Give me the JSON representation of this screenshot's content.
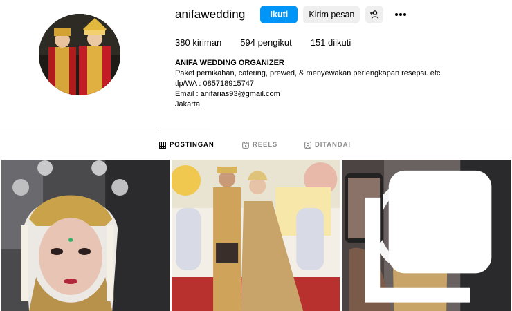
{
  "profile": {
    "username": "anifawedding",
    "follow_label": "Ikuti",
    "message_label": "Kirim pesan",
    "suggest_icon": "person-plus-icon",
    "more_icon": "more-dots-icon"
  },
  "stats": {
    "posts_count": "380",
    "posts_label": "kiriman",
    "followers_count": "594",
    "followers_label": "pengikut",
    "following_count": "151",
    "following_label": "diikuti"
  },
  "bio": {
    "name": "ANIFA WEDDING ORGANIZER",
    "line1": "Paket pernikahan, catering, prewed, & menyewakan perlengkapan resepsi. etc.",
    "line2": "tlp/WA : 085718915747",
    "line3": "Email : anifarias93@gmail.com",
    "line4": "Jakarta"
  },
  "tabs": [
    {
      "label": "POSTINGAN",
      "icon": "grid-icon",
      "active": true
    },
    {
      "label": "REELS",
      "icon": "reels-icon",
      "active": false
    },
    {
      "label": "DITANDAI",
      "icon": "tagged-icon",
      "active": false
    }
  ],
  "posts": [
    {
      "subject": "bride-closeup",
      "multi": false
    },
    {
      "subject": "couple-standing",
      "multi": false
    },
    {
      "subject": "bride-ringlight",
      "multi": true
    }
  ],
  "colors": {
    "primary_button": "#0095f6",
    "secondary_button": "#efefef",
    "muted_text": "#8e8e8e",
    "divider": "#dbdbdb"
  }
}
